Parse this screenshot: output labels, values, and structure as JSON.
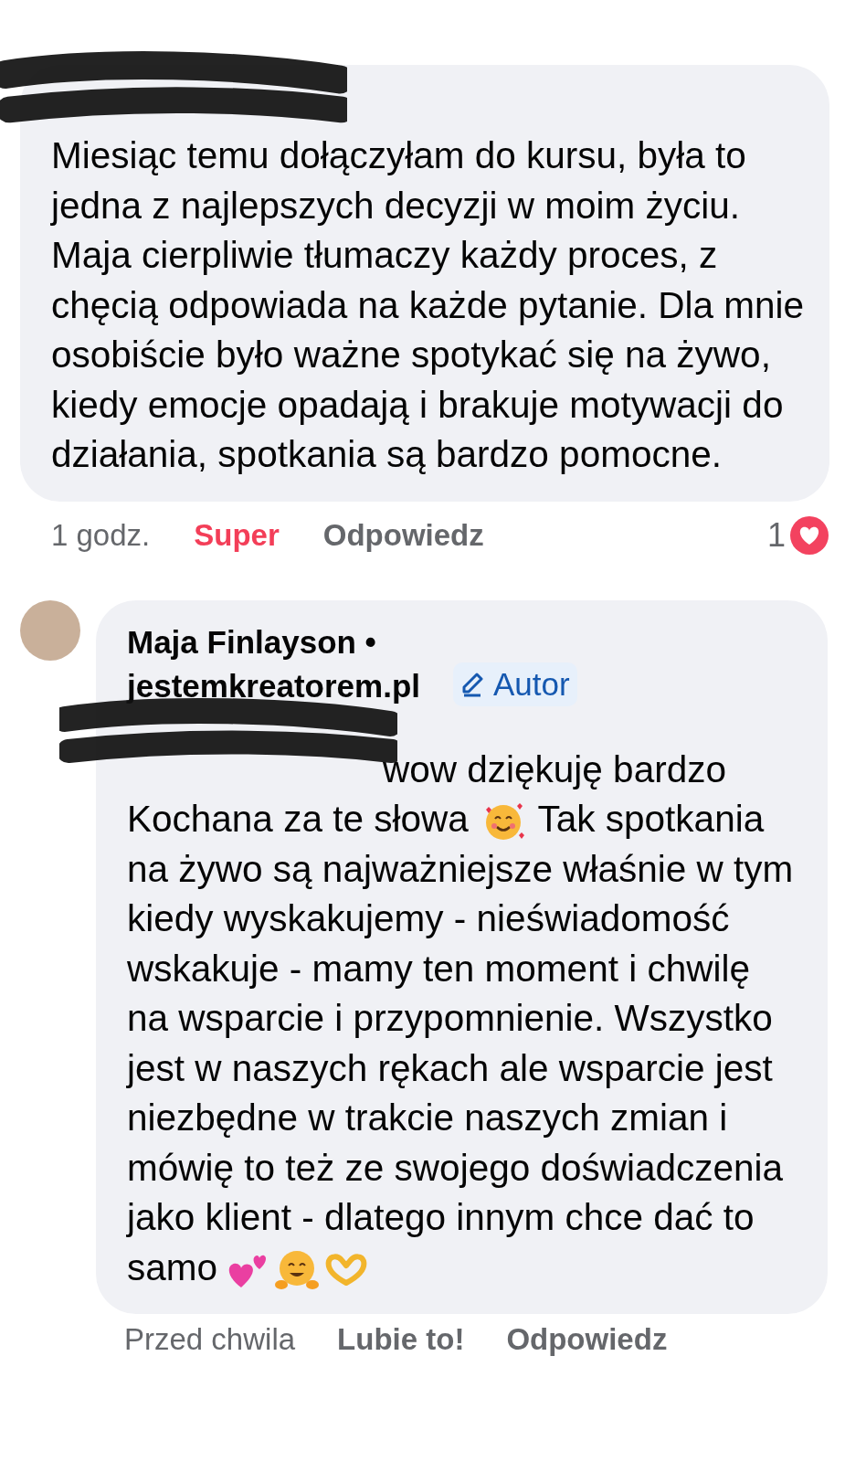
{
  "comment": {
    "text": "Miesiąc temu dołączyłam do kursu, była to jedna z najlepszych decyzji w moim życiu. Maja cierpliwie tłumaczy każdy proces, z chęcią odpowiada na każde pytanie. Dla mnie osobiście było ważne spotykać się na żywo, kiedy emocje opadają i brakuje motywacji do działania, spotkania są bardzo pomocne.",
    "time": "1 godz.",
    "reaction": "Super",
    "reacted": true,
    "reply_action": "Odpowiedz",
    "reaction_count": "1"
  },
  "reply": {
    "author": "Maja Finlayson • jestemkreatorem.pl",
    "badge": "Autor",
    "text_parts": [
      "wow dziękuję bardzo Kochana za te słowa",
      "Tak spotkania na żywo są najważniejsze właśnie w tym kiedy wyskakujemy - nieświadomość wskakuje - mamy ten moment i chwilę na wsparcie i przypomnienie. Wszystko jest w naszych rękach ale wsparcie jest niezbędne w trakcie naszych zmian i mówię to też ze swojego doświadczenia jako klient - dlatego innym chce dać to samo"
    ],
    "time": "Przed chwila",
    "reaction": "Lubie to!",
    "reacted": false,
    "reply_action": "Odpowiedz"
  }
}
